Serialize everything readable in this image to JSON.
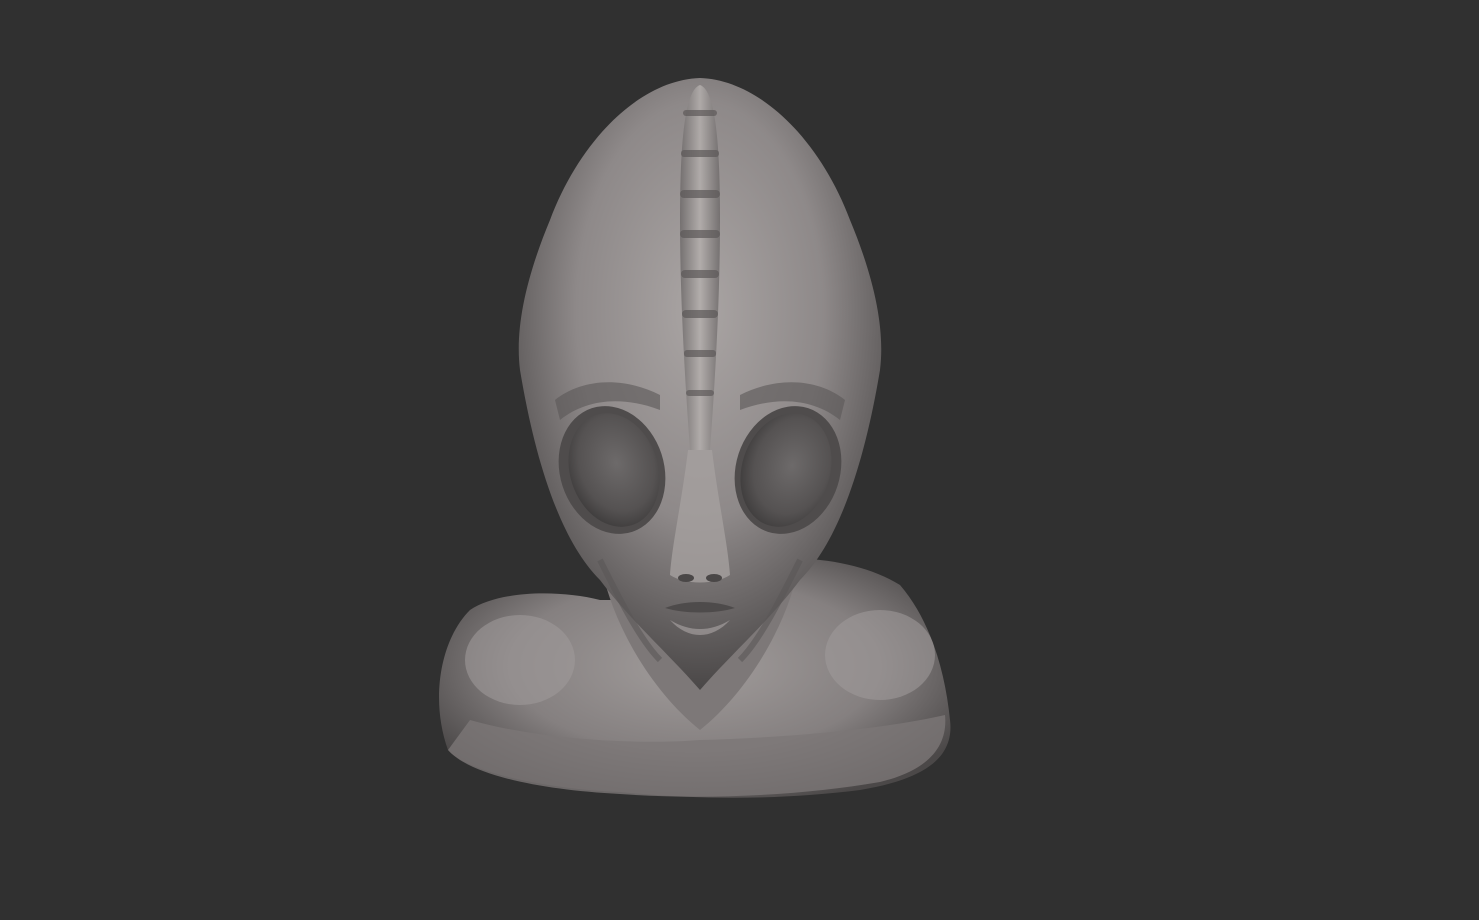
{
  "scene": {
    "background_color": "#303030",
    "subject": "alien-bust-sculpt",
    "material_color": "#8a8686",
    "highlight_color": "#b3aeac",
    "shadow_color": "#3a3838"
  }
}
